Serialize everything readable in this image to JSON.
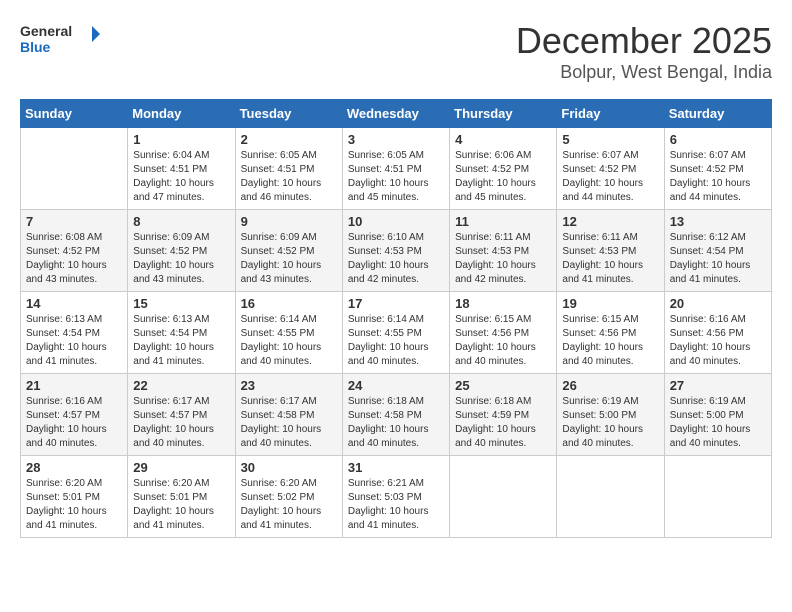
{
  "header": {
    "logo_line1": "General",
    "logo_line2": "Blue",
    "title": "December 2025",
    "subtitle": "Bolpur, West Bengal, India"
  },
  "calendar": {
    "weekdays": [
      "Sunday",
      "Monday",
      "Tuesday",
      "Wednesday",
      "Thursday",
      "Friday",
      "Saturday"
    ],
    "weeks": [
      [
        {
          "day": "",
          "info": ""
        },
        {
          "day": "1",
          "info": "Sunrise: 6:04 AM\nSunset: 4:51 PM\nDaylight: 10 hours\nand 47 minutes."
        },
        {
          "day": "2",
          "info": "Sunrise: 6:05 AM\nSunset: 4:51 PM\nDaylight: 10 hours\nand 46 minutes."
        },
        {
          "day": "3",
          "info": "Sunrise: 6:05 AM\nSunset: 4:51 PM\nDaylight: 10 hours\nand 45 minutes."
        },
        {
          "day": "4",
          "info": "Sunrise: 6:06 AM\nSunset: 4:52 PM\nDaylight: 10 hours\nand 45 minutes."
        },
        {
          "day": "5",
          "info": "Sunrise: 6:07 AM\nSunset: 4:52 PM\nDaylight: 10 hours\nand 44 minutes."
        },
        {
          "day": "6",
          "info": "Sunrise: 6:07 AM\nSunset: 4:52 PM\nDaylight: 10 hours\nand 44 minutes."
        }
      ],
      [
        {
          "day": "7",
          "info": "Sunrise: 6:08 AM\nSunset: 4:52 PM\nDaylight: 10 hours\nand 43 minutes."
        },
        {
          "day": "8",
          "info": "Sunrise: 6:09 AM\nSunset: 4:52 PM\nDaylight: 10 hours\nand 43 minutes."
        },
        {
          "day": "9",
          "info": "Sunrise: 6:09 AM\nSunset: 4:52 PM\nDaylight: 10 hours\nand 43 minutes."
        },
        {
          "day": "10",
          "info": "Sunrise: 6:10 AM\nSunset: 4:53 PM\nDaylight: 10 hours\nand 42 minutes."
        },
        {
          "day": "11",
          "info": "Sunrise: 6:11 AM\nSunset: 4:53 PM\nDaylight: 10 hours\nand 42 minutes."
        },
        {
          "day": "12",
          "info": "Sunrise: 6:11 AM\nSunset: 4:53 PM\nDaylight: 10 hours\nand 41 minutes."
        },
        {
          "day": "13",
          "info": "Sunrise: 6:12 AM\nSunset: 4:54 PM\nDaylight: 10 hours\nand 41 minutes."
        }
      ],
      [
        {
          "day": "14",
          "info": "Sunrise: 6:13 AM\nSunset: 4:54 PM\nDaylight: 10 hours\nand 41 minutes."
        },
        {
          "day": "15",
          "info": "Sunrise: 6:13 AM\nSunset: 4:54 PM\nDaylight: 10 hours\nand 41 minutes."
        },
        {
          "day": "16",
          "info": "Sunrise: 6:14 AM\nSunset: 4:55 PM\nDaylight: 10 hours\nand 40 minutes."
        },
        {
          "day": "17",
          "info": "Sunrise: 6:14 AM\nSunset: 4:55 PM\nDaylight: 10 hours\nand 40 minutes."
        },
        {
          "day": "18",
          "info": "Sunrise: 6:15 AM\nSunset: 4:56 PM\nDaylight: 10 hours\nand 40 minutes."
        },
        {
          "day": "19",
          "info": "Sunrise: 6:15 AM\nSunset: 4:56 PM\nDaylight: 10 hours\nand 40 minutes."
        },
        {
          "day": "20",
          "info": "Sunrise: 6:16 AM\nSunset: 4:56 PM\nDaylight: 10 hours\nand 40 minutes."
        }
      ],
      [
        {
          "day": "21",
          "info": "Sunrise: 6:16 AM\nSunset: 4:57 PM\nDaylight: 10 hours\nand 40 minutes."
        },
        {
          "day": "22",
          "info": "Sunrise: 6:17 AM\nSunset: 4:57 PM\nDaylight: 10 hours\nand 40 minutes."
        },
        {
          "day": "23",
          "info": "Sunrise: 6:17 AM\nSunset: 4:58 PM\nDaylight: 10 hours\nand 40 minutes."
        },
        {
          "day": "24",
          "info": "Sunrise: 6:18 AM\nSunset: 4:58 PM\nDaylight: 10 hours\nand 40 minutes."
        },
        {
          "day": "25",
          "info": "Sunrise: 6:18 AM\nSunset: 4:59 PM\nDaylight: 10 hours\nand 40 minutes."
        },
        {
          "day": "26",
          "info": "Sunrise: 6:19 AM\nSunset: 5:00 PM\nDaylight: 10 hours\nand 40 minutes."
        },
        {
          "day": "27",
          "info": "Sunrise: 6:19 AM\nSunset: 5:00 PM\nDaylight: 10 hours\nand 40 minutes."
        }
      ],
      [
        {
          "day": "28",
          "info": "Sunrise: 6:20 AM\nSunset: 5:01 PM\nDaylight: 10 hours\nand 41 minutes."
        },
        {
          "day": "29",
          "info": "Sunrise: 6:20 AM\nSunset: 5:01 PM\nDaylight: 10 hours\nand 41 minutes."
        },
        {
          "day": "30",
          "info": "Sunrise: 6:20 AM\nSunset: 5:02 PM\nDaylight: 10 hours\nand 41 minutes."
        },
        {
          "day": "31",
          "info": "Sunrise: 6:21 AM\nSunset: 5:03 PM\nDaylight: 10 hours\nand 41 minutes."
        },
        {
          "day": "",
          "info": ""
        },
        {
          "day": "",
          "info": ""
        },
        {
          "day": "",
          "info": ""
        }
      ]
    ]
  }
}
